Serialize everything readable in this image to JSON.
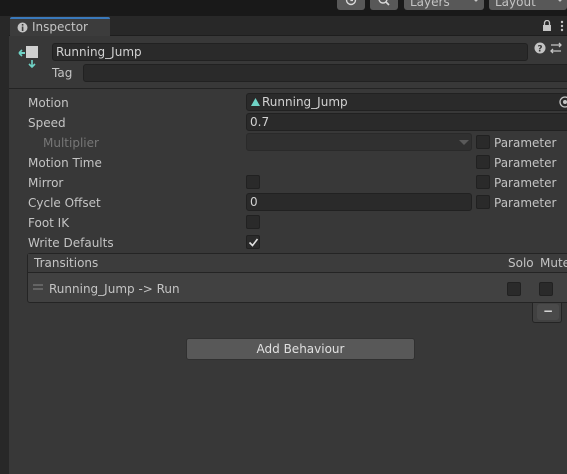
{
  "top_toolbar": {
    "layers_label": "Layers",
    "layout_label": "Layout"
  },
  "tab": {
    "title": "Inspector"
  },
  "header": {
    "name_value": "Running_Jump",
    "tag_label": "Tag",
    "tag_value": ""
  },
  "properties": {
    "motion_label": "Motion",
    "motion_value": "Running_Jump",
    "speed_label": "Speed",
    "speed_value": "0.7",
    "multiplier_label": "Multiplier",
    "motion_time_label": "Motion Time",
    "mirror_label": "Mirror",
    "cycle_offset_label": "Cycle Offset",
    "cycle_offset_value": "0",
    "foot_ik_label": "Foot IK",
    "write_defaults_label": "Write Defaults",
    "parameter_label": "Parameter",
    "checkbox_states": {
      "multiplier_parameter": false,
      "motion_time_parameter": false,
      "mirror": false,
      "mirror_parameter": false,
      "cycle_offset_parameter": false,
      "foot_ik": false,
      "write_defaults": true
    }
  },
  "transitions": {
    "header_label": "Transitions",
    "solo_label": "Solo",
    "mute_label": "Mute",
    "rows": [
      {
        "name": "Running_Jump -> Run",
        "solo": false,
        "mute": false
      }
    ],
    "remove_label": "−"
  },
  "add_behaviour_label": "Add Behaviour",
  "colors": {
    "panel_bg": "#383838",
    "field_bg": "#2a2a2a",
    "tab_accent": "#3a79bb",
    "text": "#c4c4c4",
    "icon_accent": "#6fd3c6"
  }
}
